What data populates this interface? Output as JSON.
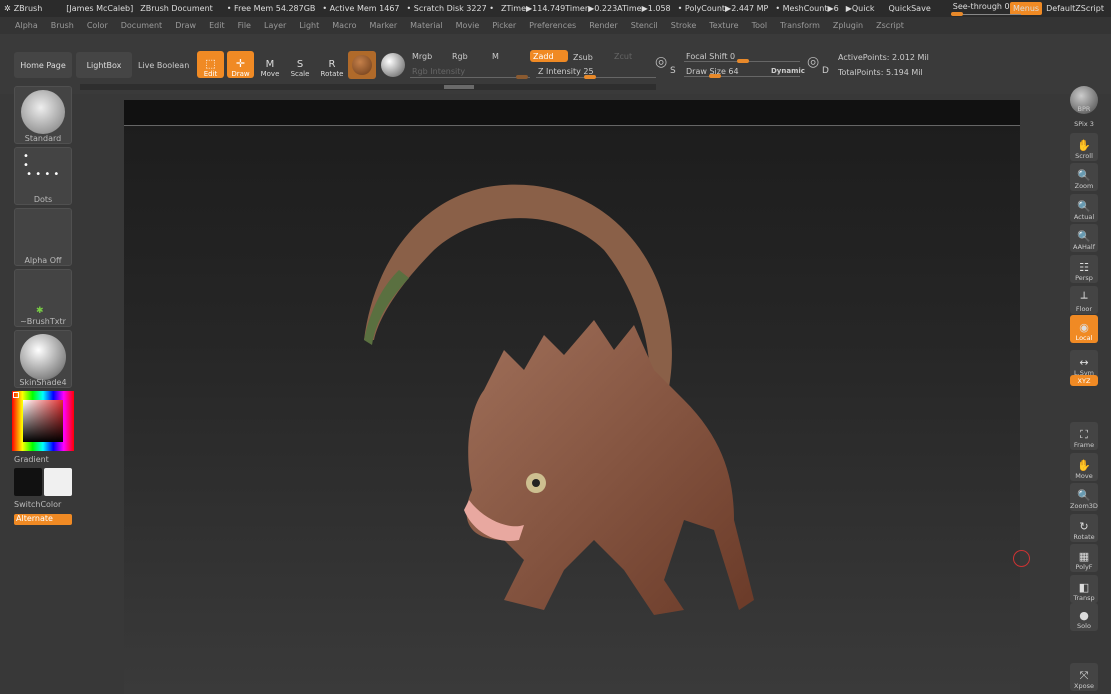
{
  "titlebar": {
    "app": "ZBrush",
    "user": "[James McCaleb]",
    "doc": "ZBrush Document",
    "free_mem": "• Free Mem 54.287GB",
    "active_mem": "• Active Mem 1467",
    "scratch": "• Scratch Disk 3227 •",
    "ztime": "ZTime▶114.749",
    "timer": "Timer▶0.223",
    "atime": "ATime▶1.058",
    "polycount": "• PolyCount▶2.447 MP",
    "meshcount": "• MeshCount▶6",
    "quick": "▶Quick",
    "quicksave": "QuickSave",
    "see_through": "See-through  0",
    "see_through_value": 0,
    "menus": "Menus",
    "script": "DefaultZScript"
  },
  "menu": [
    "Alpha",
    "Brush",
    "Color",
    "Document",
    "Draw",
    "Edit",
    "File",
    "Layer",
    "Light",
    "Macro",
    "Marker",
    "Material",
    "Movie",
    "Picker",
    "Preferences",
    "Render",
    "Stencil",
    "Stroke",
    "Texture",
    "Tool",
    "Transform",
    "Zplugin",
    "Zscript"
  ],
  "toolbar": {
    "home": "Home Page",
    "lightbox": "LightBox",
    "live_boolean": "Live Boolean",
    "edit": "Edit",
    "draw": "Draw",
    "move": "Move",
    "scale": "Scale",
    "rotate": "Rotate",
    "mrgb": "Mrgb",
    "rgb": "Rgb",
    "m": "M",
    "zadd": "Zadd",
    "zsub": "Zsub",
    "zcut": "Zcut",
    "rgb_intensity": "Rgb Intensity",
    "z_intensity": "Z Intensity 25",
    "z_intensity_value": 25,
    "focal_shift": "Focal Shift 0",
    "focal_shift_value": 0,
    "draw_size": "Draw Size 64",
    "draw_size_value": 64,
    "dynamic": "Dynamic",
    "active_points": "ActivePoints: 2.012 Mil",
    "total_points": "TotalPoints: 5.194 Mil",
    "s": "S",
    "d": "D"
  },
  "left": {
    "standard": "Standard",
    "dots": "Dots",
    "alpha": "Alpha Off",
    "texture": "~BrushTxtr",
    "material": "SkinShade4",
    "gradient": "Gradient",
    "switch": "SwitchColor",
    "alternate": "Alternate",
    "colors": {
      "primary": "#111111",
      "secondary": "#f0f0f0"
    }
  },
  "right": [
    {
      "label": "BPR"
    },
    {
      "label": "SPix 3"
    },
    {
      "label": "Scroll",
      "icon": "✋"
    },
    {
      "label": "Zoom",
      "icon": "🔍"
    },
    {
      "label": "Actual",
      "icon": "🔍"
    },
    {
      "label": "AAHalf",
      "icon": "🔍"
    },
    {
      "label": "Persp",
      "icon": "☷"
    },
    {
      "label": "Floor",
      "icon": "┴"
    },
    {
      "label": "Local",
      "icon": "◉"
    },
    {
      "label": "L.Sym",
      "icon": "↔"
    },
    {
      "label": "XYZ"
    },
    {
      "label": "Frame",
      "icon": "⛶"
    },
    {
      "label": "Move",
      "icon": "✋"
    },
    {
      "label": "Zoom3D",
      "icon": "🔍"
    },
    {
      "label": "Rotate",
      "icon": "↻"
    },
    {
      "label": "PolyF",
      "icon": "▦"
    },
    {
      "label": "Transp",
      "icon": "◧"
    },
    {
      "label": "Solo",
      "icon": "●"
    },
    {
      "label": "Xpose",
      "icon": "⤧"
    }
  ],
  "accent": "#f08a24"
}
